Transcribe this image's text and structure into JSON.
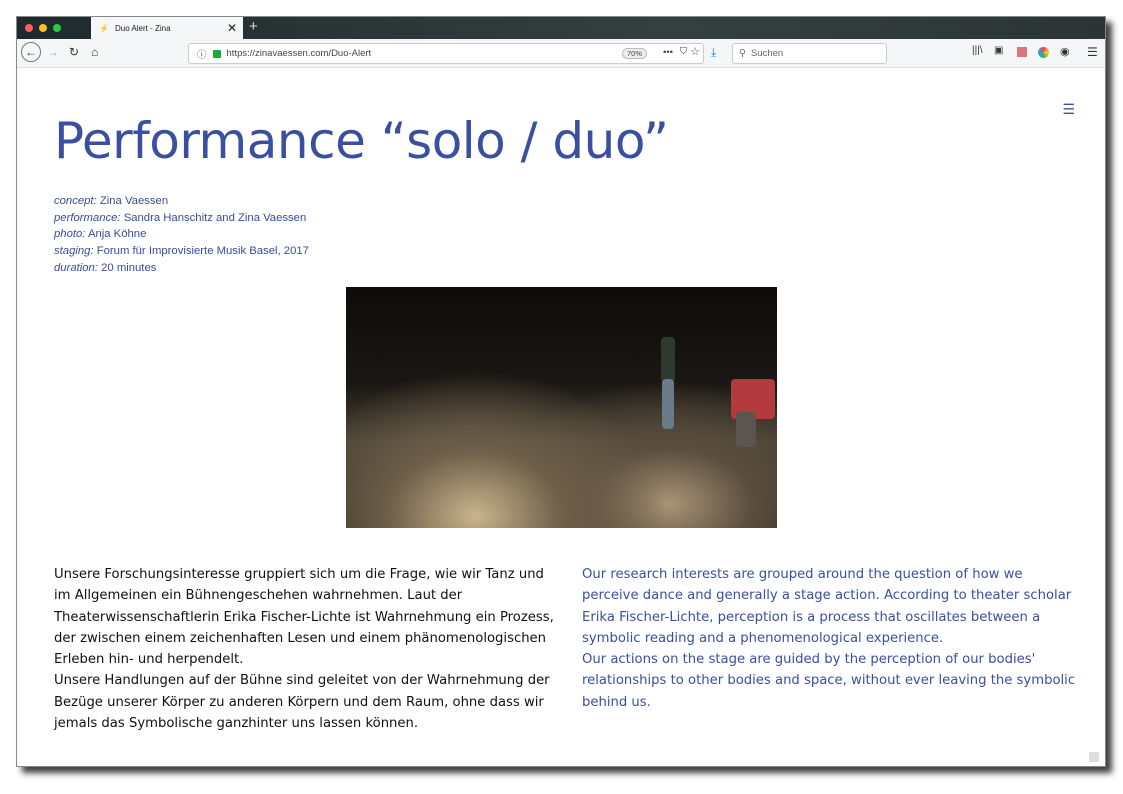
{
  "browser": {
    "tab_title": "Duo Alert - Zina",
    "url": "https://zinavaessen.com/Duo-Alert",
    "zoom": "70%",
    "search_placeholder": "Suchen"
  },
  "page": {
    "title": "Performance “solo / duo”",
    "credits": [
      {
        "label": "concept:",
        "value": "Zina Vaessen"
      },
      {
        "label": "performance:",
        "value": "Sandra Hanschitz and Zina Vaessen"
      },
      {
        "label": "photo:",
        "value": "Anja Köhne"
      },
      {
        "label": "staging:",
        "value": "Forum für Improvisierte Musik Basel, 2017"
      },
      {
        "label": "duration:",
        "value": "20 minutes"
      }
    ],
    "text_de_1": "Unsere Forschungsinteresse gruppiert sich um die Frage, wie wir Tanz und im Allgemeinen ein Bühnengeschehen wahrnehmen. Laut der Theaterwissenschaftlerin Erika Fischer-Lichte ist Wahrnehmung ein Prozess, der zwischen einem zeichenhaften Lesen und einem phänomenologischen Erleben hin- und herpendelt.",
    "text_de_2": "Unsere Handlungen auf der Bühne sind geleitet von der Wahrnehmung der Bezüge unserer Körper zu anderen Körpern und dem Raum, ohne dass wir jemals das Symbolische ganzhinter uns lassen können.",
    "text_en_1": "Our research interests are grouped around the question of how we perceive dance and generally a stage action. According to theater scholar Erika Fischer-Lichte, perception is a process that oscillates between a symbolic reading and a phenomenological experience.",
    "text_en_2": "Our actions on the stage are guided by the perception of our bodies' relationships to other bodies and space, without ever leaving the symbolic behind us."
  }
}
